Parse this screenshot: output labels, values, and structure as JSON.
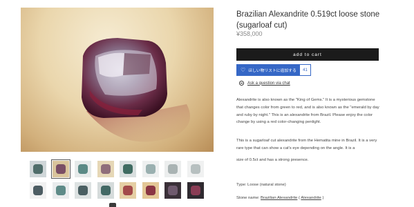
{
  "product": {
    "title": "Brazilian Alexandrite 0.519ct loose stone (sugarloaf cut)",
    "price": "¥358,000"
  },
  "actions": {
    "cart_label": "add to cart",
    "favorite_label": "ほしい物リストに追加する",
    "favorite_count": "41",
    "ask_label": "Ask a question via chat"
  },
  "description": {
    "p1": "Alexandrite is also known as the \"King of Gems.\" It is a mysterious gemstone that changes color from green to red, and is also known as the \"emerald by day and ruby by night.\" This is an alexandrite from Brazil. Please enjoy the color change by using a red color-changing penlight.",
    "p2": "This is a sugarloaf cut alexandrite from the Hematita mine in Brazil. It is a very rare type that can show a cat's eye depending on the angle. It is a",
    "p3": "size of 0.5ct and has a strong presence.",
    "type_line": "Type: Loose (natural stone)",
    "stone_prefix": "Stone name: ",
    "stone_link1": "Brazilian Alexandrite",
    "stone_paren_open": " ( ",
    "stone_link2": "Alexandrite",
    "stone_paren_close": " )"
  },
  "thumbnails": {
    "count_per_row": 8,
    "selected_index": 1
  },
  "icons": {
    "favorite": "heart-icon",
    "ask": "chat-icon"
  },
  "colors": {
    "cart_button": "#1b1b1b",
    "favorite_button": "#3567c6"
  }
}
